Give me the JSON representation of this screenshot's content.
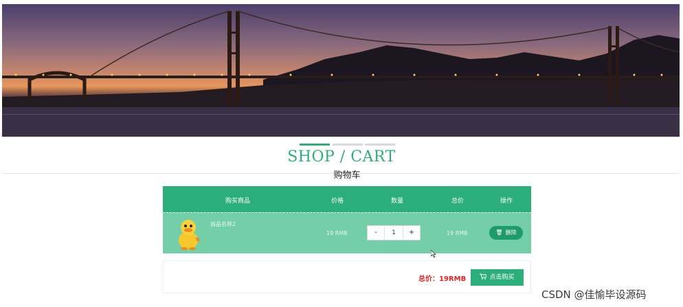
{
  "page": {
    "title_en": "SHOP / CART",
    "title_zh": "购物车"
  },
  "colors": {
    "accent": "#2bae7a",
    "row_bg": "#74cfa9",
    "price_red": "#e02424"
  },
  "cart": {
    "headers": [
      "购买商品",
      "价格",
      "数量",
      "总价",
      "操作"
    ],
    "items": [
      {
        "name": "商品名称2",
        "price": "19 RMB",
        "qty": "1",
        "total": "19 RMB",
        "delete_label": "删除",
        "delete_icon": "trash-icon",
        "image_icon": "duck-product-image"
      }
    ],
    "qty_minus": "-",
    "qty_plus": "+"
  },
  "summary": {
    "total_text": "总价：19RMB",
    "buy_label": "点击购买",
    "buy_icon": "cart-icon"
  },
  "watermark": "CSDN @佳愉毕设源码"
}
